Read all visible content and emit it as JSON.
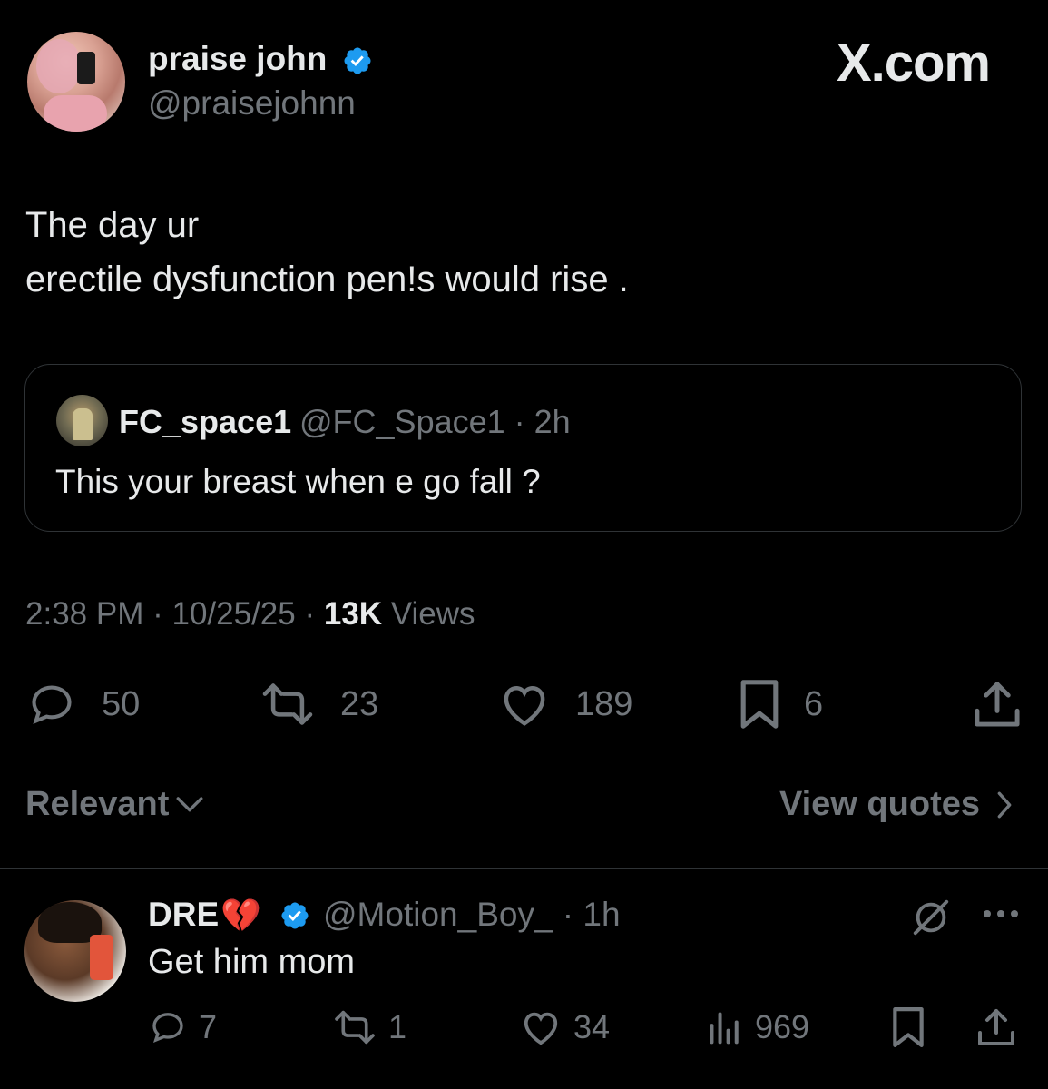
{
  "colors": {
    "background": "#000000",
    "primary_text": "#e7e9ea",
    "secondary_text": "#71767b",
    "verified_blue": "#1d9bf0",
    "border": "#2f3336"
  },
  "header": {
    "display_name": "praise john",
    "handle": "@praisejohnn",
    "brand": "X.com"
  },
  "tweet": {
    "text": "The day ur\nerectile dysfunction pen!s would rise ."
  },
  "quoted_tweet": {
    "name": "FC_space1",
    "handle_time": "@FC_Space1 · 2h",
    "text": "This your breast when e go fall ?"
  },
  "meta": {
    "time": "2:38 PM",
    "date": "10/25/25",
    "views_count": "13K",
    "views_label": "Views"
  },
  "actions": {
    "replies": "50",
    "reposts": "23",
    "likes": "189",
    "bookmarks": "6"
  },
  "sort": {
    "relevant_label": "Relevant",
    "view_quotes_label": "View quotes"
  },
  "reply": {
    "name": "DRE",
    "emoji": "💔",
    "handle_time": "@Motion_Boy_ · 1h",
    "text": "Get him mom",
    "replies": "7",
    "reposts": "1",
    "likes": "34",
    "views": "969"
  },
  "icons": [
    "reply-icon",
    "repost-icon",
    "like-icon",
    "bookmark-icon",
    "share-icon",
    "verified-icon",
    "chevron-down-icon",
    "chevron-right-icon",
    "grok-icon",
    "more-icon",
    "views-icon"
  ]
}
